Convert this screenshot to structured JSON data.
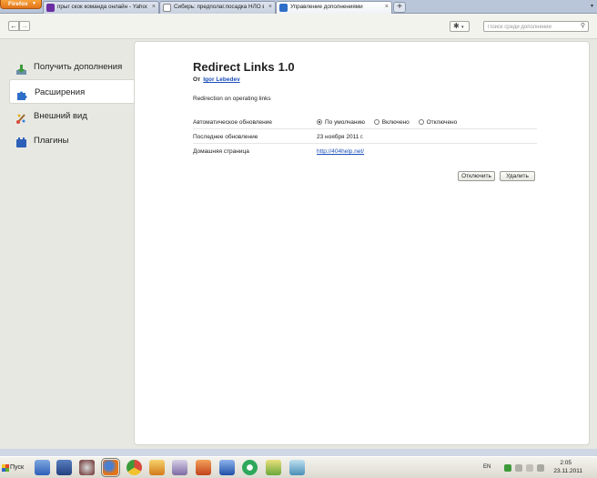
{
  "browser": {
    "menu_button_label": "Firefox",
    "tabs": [
      {
        "title": "прыг скок команда онлайн - Yahoo! Vid...",
        "favicon": "yahoo-icon",
        "color": "#6b2fa3"
      },
      {
        "title": "Сибирь: предполаг.посадка НЛО в Ус...",
        "favicon": "page-icon",
        "color": "#ffffff"
      },
      {
        "title": "Управление дополнениями",
        "favicon": "puzzle-icon",
        "color": "#2e6ec9",
        "active": true
      }
    ],
    "new_tab_label": "+",
    "tab_list_label": "▾"
  },
  "toolbar": {
    "back_glyph": "←",
    "forward_glyph": "→",
    "gear_glyph": "✱",
    "search_placeholder": "Поиск среди дополнений",
    "search_glyph": "⚲"
  },
  "sidebar": {
    "items": [
      {
        "label": "Получить дополнения",
        "icon": "download-icon"
      },
      {
        "label": "Расширения",
        "icon": "puzzle-icon",
        "selected": true
      },
      {
        "label": "Внешний вид",
        "icon": "paintbrush-icon"
      },
      {
        "label": "Плагины",
        "icon": "plugin-block-icon"
      }
    ]
  },
  "addon": {
    "name": "Redirect Links",
    "version": "1.0",
    "author_prefix": "От",
    "author": "Igor Lebedev",
    "description": "Redirection on operating links",
    "details": {
      "auto_update_label": "Автоматическое обновление",
      "auto_update_options": [
        "По умолчанию",
        "Включено",
        "Отключено"
      ],
      "auto_update_selected": "По умолчанию",
      "last_updated_label": "Последнее обновление",
      "last_updated_value": "23 ноября 2011 г.",
      "homepage_label": "Домашняя страница",
      "homepage_value": "http://404help.net/"
    },
    "buttons": {
      "disable": "Отключить",
      "remove": "Удалить"
    }
  },
  "taskbar": {
    "start_label": "Пуск",
    "language": "EN",
    "time": "2:05",
    "date": "23.11.2011"
  }
}
